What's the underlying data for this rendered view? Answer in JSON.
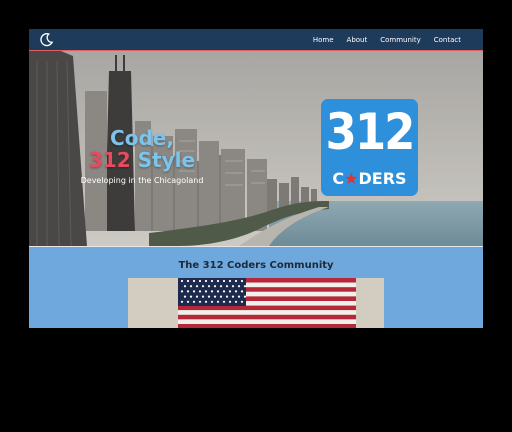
{
  "nav": {
    "links": [
      "Home",
      "About",
      "Community",
      "Contact"
    ],
    "theme_icon": "moon-icon"
  },
  "hero": {
    "headline_line1": "Code,",
    "headline_num": "312",
    "headline_style": "Style",
    "tagline": "Developing in the Chicagoland",
    "logo_number": "312",
    "logo_word_pre": "C",
    "logo_word_star": "★",
    "logo_word_post": "DERS"
  },
  "community": {
    "title": "The 312 Coders Community"
  },
  "colors": {
    "nav_bg": "#1e3b5c",
    "section_bg": "#6fa8dc",
    "logo_bg": "#2e8fdb",
    "accent_red": "#e84a5f",
    "accent_blue": "#7cc4ec"
  }
}
